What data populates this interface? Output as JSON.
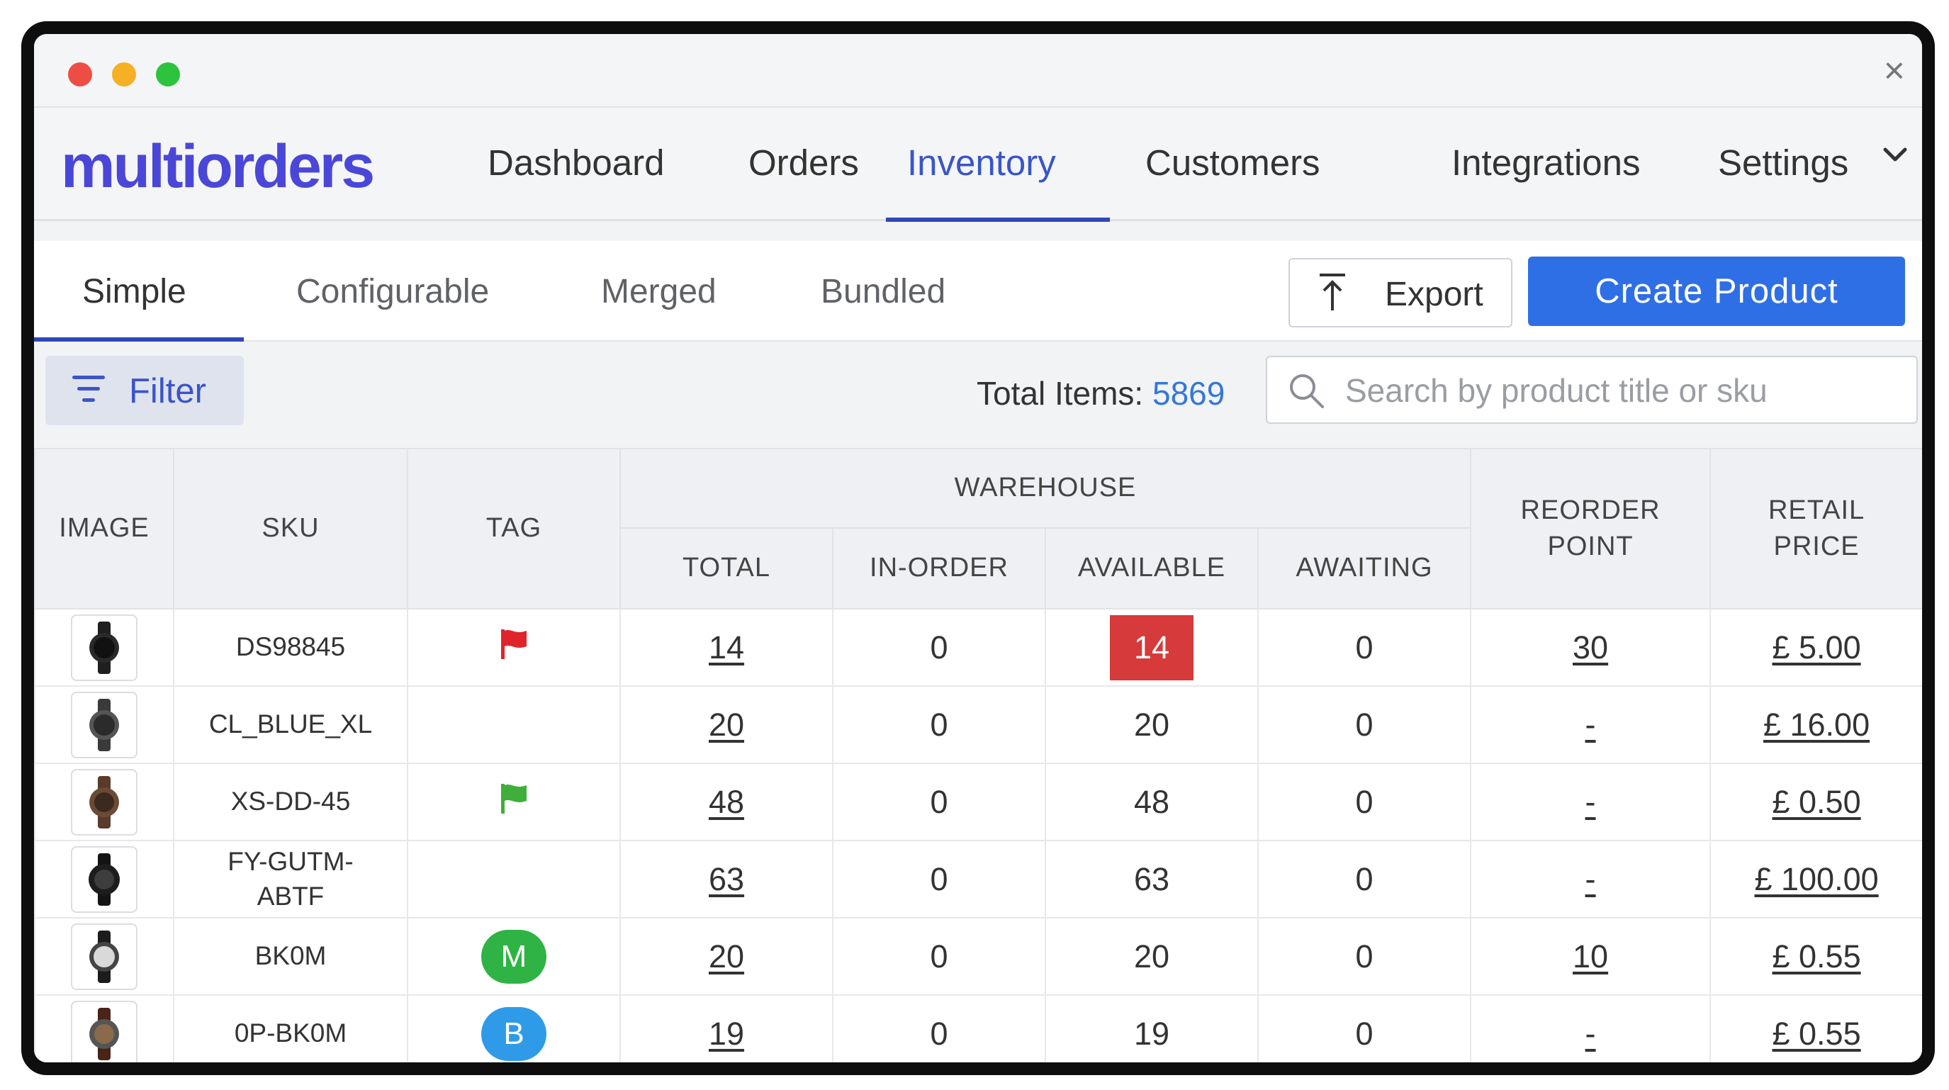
{
  "window": {
    "close_label": "×"
  },
  "brand": {
    "logo": "multiorders",
    "logo_color": "#4a47d8"
  },
  "nav": {
    "items": [
      "Dashboard",
      "Orders",
      "Inventory",
      "Customers",
      "Integrations",
      "Settings"
    ],
    "active": "Inventory"
  },
  "product_tabs": [
    "Simple",
    "Configurable",
    "Merged",
    "Bundled"
  ],
  "active_tab": "Simple",
  "actions": {
    "export_label": "Export",
    "create_label": "Create Product"
  },
  "filter": {
    "label": "Filter"
  },
  "summary": {
    "total_label": "Total Items:",
    "total_value": "5869"
  },
  "search": {
    "placeholder": "Search by product title or sku",
    "value": ""
  },
  "table": {
    "headers": {
      "image": "IMAGE",
      "sku": "SKU",
      "tag": "TAG",
      "warehouse": "WAREHOUSE",
      "total": "TOTAL",
      "in_order": "IN-ORDER",
      "available": "AVAILABLE",
      "awaiting": "AWAITING",
      "reorder_line1": "REORDER",
      "reorder_line2": "POINT",
      "retail_line1": "RETAIL",
      "retail_line2": "PRICE"
    },
    "rows": [
      {
        "sku": "DS98845",
        "tag": "red-flag-icon",
        "total": "14",
        "in_order": "0",
        "available": "14",
        "awaiting": "0",
        "reorder": "30",
        "price": "£ 5.00"
      },
      {
        "sku": "CL_BLUE_XL",
        "tag": "",
        "total": "20",
        "in_order": "0",
        "available": "20",
        "awaiting": "0",
        "reorder": "-",
        "price": "£ 16.00"
      },
      {
        "sku": "XS-DD-45",
        "tag": "green-flag-icon",
        "total": "48",
        "in_order": "0",
        "available": "48",
        "awaiting": "0",
        "reorder": "-",
        "price": "£ 0.50"
      },
      {
        "sku_line1": "FY-GUTM-",
        "sku_line2": "ABTF",
        "tag": "",
        "total": "63",
        "in_order": "0",
        "available": "63",
        "awaiting": "0",
        "reorder": "-",
        "price": "£ 100.00"
      },
      {
        "sku": "BK0M",
        "tag": "M",
        "total": "20",
        "in_order": "0",
        "available": "20",
        "awaiting": "0",
        "reorder": "10",
        "price": "£ 0.55"
      },
      {
        "sku": "0P-BK0M",
        "tag": "B",
        "total": "19",
        "in_order": "0",
        "available": "19",
        "awaiting": "0",
        "reorder": "-",
        "price": "£ 0.55"
      }
    ]
  },
  "colors": {
    "primary": "#2f6fe6",
    "nav_active": "#3a55c8",
    "low_stock": "#d63a3a",
    "flag_red": "#e0242c",
    "flag_green": "#3fae3a",
    "tag_m": "#2fb344",
    "tag_b": "#2f9be8",
    "total_count": "#3478d8"
  }
}
